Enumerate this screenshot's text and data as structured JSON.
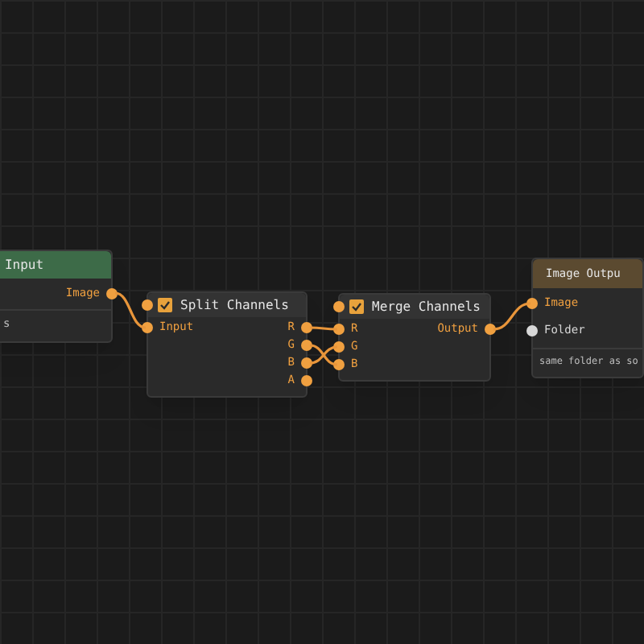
{
  "nodes": [
    {
      "title": "Input",
      "color": "#3d6b48",
      "field": "s",
      "outputs": [
        {
          "label": "Image",
          "color": "#f0a040"
        }
      ]
    },
    {
      "title": "Split Channels",
      "color": "#333333",
      "toggle": {
        "checked": true
      },
      "inputs": [
        {
          "label": "Input",
          "color": "#f0a040"
        }
      ],
      "outputs": [
        {
          "label": "R",
          "color": "#f0a040"
        },
        {
          "label": "G",
          "color": "#f0a040"
        },
        {
          "label": "B",
          "color": "#f0a040"
        },
        {
          "label": "A",
          "color": "#f0a040"
        }
      ]
    },
    {
      "title": "Merge Channels",
      "color": "#333333",
      "toggle": {
        "checked": true
      },
      "inputs": [
        {
          "label": "R",
          "color": "#f0a040"
        },
        {
          "label": "G",
          "color": "#f0a040"
        },
        {
          "label": "B",
          "color": "#f0a040"
        }
      ],
      "outputs": [
        {
          "label": "Output",
          "color": "#f0a040"
        }
      ]
    },
    {
      "title": "Image Outpu",
      "color": "#5b4a30",
      "field": "same folder as so",
      "inputs": [
        {
          "label": "Image",
          "color": "#f0a040"
        },
        {
          "label": "Folder",
          "color": "#d8d8d8"
        }
      ]
    }
  ]
}
